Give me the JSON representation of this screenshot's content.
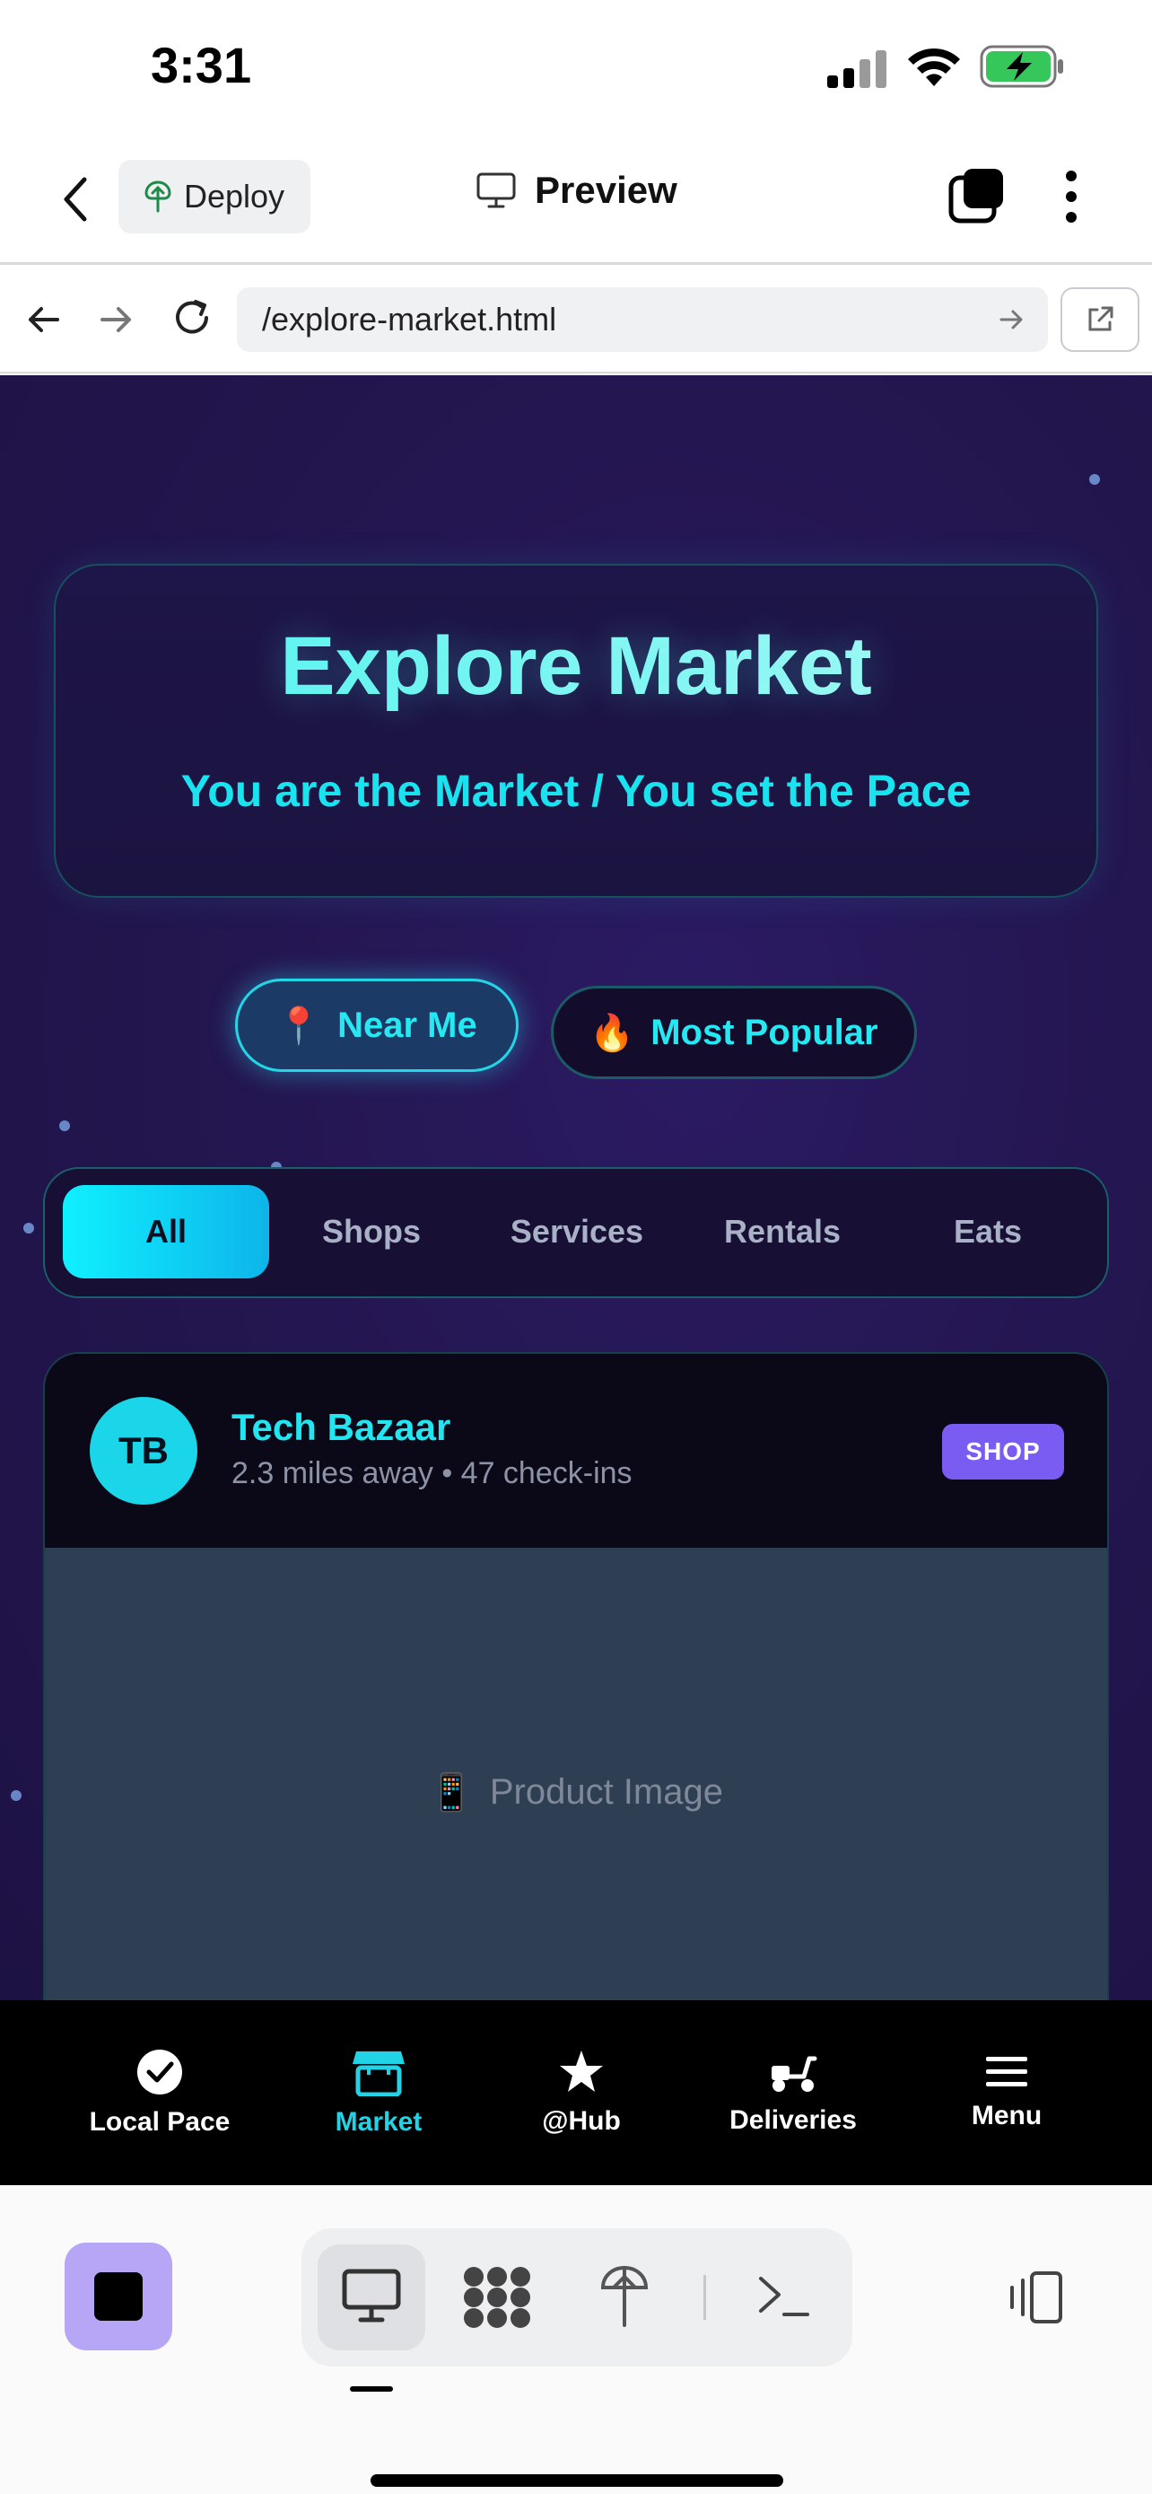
{
  "status": {
    "time": "3:31"
  },
  "appbar": {
    "deploy_label": "Deploy",
    "preview_label": "Preview"
  },
  "browser": {
    "url": "/explore-market.html"
  },
  "hero": {
    "title": "Explore Market",
    "subtitle": "You are the Market / You set the Pace"
  },
  "filters": {
    "near_me": "Near Me",
    "near_me_emoji": "📍",
    "most_popular": "Most Popular",
    "most_popular_emoji": "🔥"
  },
  "tabs": [
    "All",
    "Shops",
    "Services",
    "Rentals",
    "Eats"
  ],
  "active_tab": "All",
  "card": {
    "initials": "TB",
    "name": "Tech Bazaar",
    "meta": "2.3 miles away • 47 check-ins",
    "badge": "SHOP",
    "image_emoji": "📱",
    "image_label": "Product Image"
  },
  "nav": [
    {
      "label": "Local Pace",
      "icon": "check-circle-icon"
    },
    {
      "label": "Market",
      "icon": "store-icon",
      "active": true
    },
    {
      "label": "@Hub",
      "icon": "star-icon"
    },
    {
      "label": "Deliveries",
      "icon": "scooter-icon"
    },
    {
      "label": "Menu",
      "icon": "hamburger-icon"
    }
  ],
  "colors": {
    "accent": "#22D3E6",
    "badge": "#7B5CF3",
    "background": "#241650"
  }
}
